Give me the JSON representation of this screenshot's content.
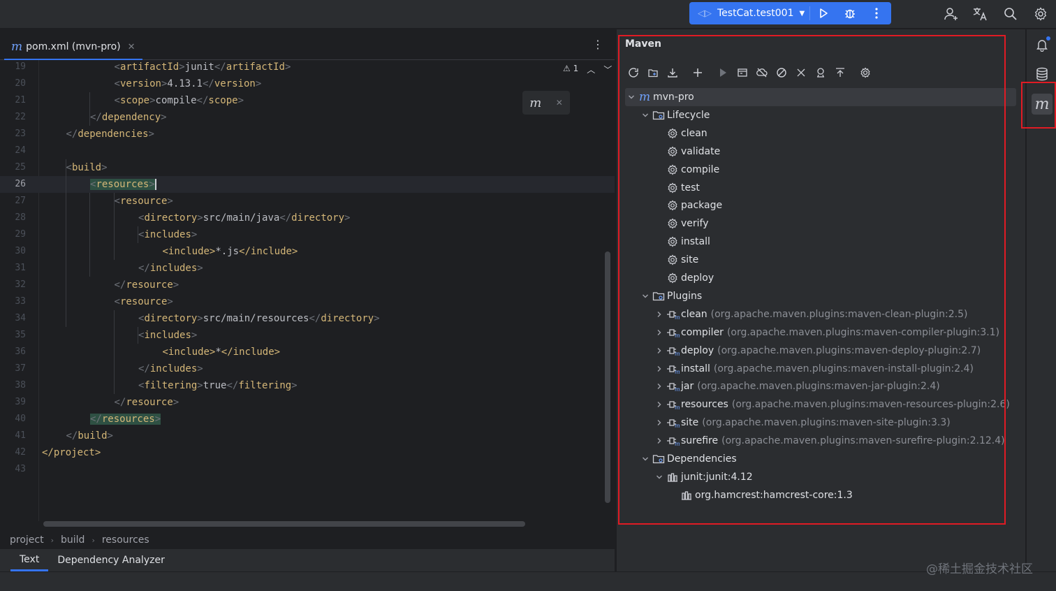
{
  "titlebar": {
    "run_config": "TestCat.test001",
    "icons": [
      "run-icon",
      "debug-icon",
      "more-vertical-icon",
      "add-user-icon",
      "translate-icon",
      "search-icon",
      "settings-icon"
    ]
  },
  "editor": {
    "tab": {
      "icon": "m",
      "label": "pom.xml (mvn-pro)"
    },
    "inspection": {
      "warnings": "1"
    },
    "popup_icon": "m",
    "lines": [
      {
        "n": "19",
        "i": 3,
        "seg": [
          [
            "br",
            "<"
          ],
          [
            "tg",
            "artifactId"
          ],
          [
            "br",
            ">"
          ],
          [
            "tx",
            "junit"
          ],
          [
            "br",
            "</"
          ],
          [
            "tg",
            "artifactId"
          ],
          [
            "br",
            ">"
          ]
        ]
      },
      {
        "n": "20",
        "i": 3,
        "seg": [
          [
            "br",
            "<"
          ],
          [
            "tg",
            "version"
          ],
          [
            "br",
            ">"
          ],
          [
            "tx",
            "4.13.1"
          ],
          [
            "br",
            "</"
          ],
          [
            "tg",
            "version"
          ],
          [
            "br",
            ">"
          ]
        ]
      },
      {
        "n": "21",
        "i": 3,
        "seg": [
          [
            "br",
            "<"
          ],
          [
            "tg",
            "scope"
          ],
          [
            "br",
            ">"
          ],
          [
            "tx",
            "compile"
          ],
          [
            "br",
            "</"
          ],
          [
            "tg",
            "scope"
          ],
          [
            "br",
            ">"
          ]
        ]
      },
      {
        "n": "22",
        "i": 2,
        "seg": [
          [
            "br",
            "</"
          ],
          [
            "tg",
            "dependency"
          ],
          [
            "br",
            ">"
          ]
        ]
      },
      {
        "n": "23",
        "i": 1,
        "seg": [
          [
            "br",
            "</"
          ],
          [
            "tg",
            "dependencies"
          ],
          [
            "br",
            ">"
          ]
        ]
      },
      {
        "n": "24",
        "i": 0,
        "seg": []
      },
      {
        "n": "25",
        "i": 1,
        "seg": [
          [
            "br",
            "<"
          ],
          [
            "tg",
            "build"
          ],
          [
            "br",
            ">"
          ]
        ]
      },
      {
        "n": "26",
        "i": 2,
        "current": true,
        "seg": [
          [
            "hlbr",
            "<"
          ],
          [
            "hl",
            "resources"
          ],
          [
            "hlbr",
            ">"
          ],
          [
            "cursor",
            ""
          ]
        ]
      },
      {
        "n": "27",
        "i": 3,
        "seg": [
          [
            "br",
            "<"
          ],
          [
            "tg",
            "resource"
          ],
          [
            "br",
            ">"
          ]
        ]
      },
      {
        "n": "28",
        "i": 4,
        "seg": [
          [
            "br",
            "<"
          ],
          [
            "tg",
            "directory"
          ],
          [
            "br",
            ">"
          ],
          [
            "tx",
            "src/main/java"
          ],
          [
            "br",
            "</"
          ],
          [
            "tg",
            "directory"
          ],
          [
            "br",
            ">"
          ]
        ]
      },
      {
        "n": "29",
        "i": 4,
        "seg": [
          [
            "br",
            "<"
          ],
          [
            "tg",
            "includes"
          ],
          [
            "br",
            ">"
          ]
        ]
      },
      {
        "n": "30",
        "i": 5,
        "seg": [
          [
            "tg",
            "<include>"
          ],
          [
            "tx",
            "*.js"
          ],
          [
            "tg",
            "</include>"
          ]
        ]
      },
      {
        "n": "31",
        "i": 4,
        "seg": [
          [
            "br",
            "</"
          ],
          [
            "tg",
            "includes"
          ],
          [
            "br",
            ">"
          ]
        ]
      },
      {
        "n": "32",
        "i": 3,
        "seg": [
          [
            "br",
            "</"
          ],
          [
            "tg",
            "resource"
          ],
          [
            "br",
            ">"
          ]
        ]
      },
      {
        "n": "33",
        "i": 3,
        "seg": [
          [
            "br",
            "<"
          ],
          [
            "tg",
            "resource"
          ],
          [
            "br",
            ">"
          ]
        ]
      },
      {
        "n": "34",
        "i": 4,
        "seg": [
          [
            "br",
            "<"
          ],
          [
            "tg",
            "directory"
          ],
          [
            "br",
            ">"
          ],
          [
            "tx",
            "src/main/resources"
          ],
          [
            "br",
            "</"
          ],
          [
            "tg",
            "directory"
          ],
          [
            "br",
            ">"
          ]
        ]
      },
      {
        "n": "35",
        "i": 4,
        "seg": [
          [
            "br",
            "<"
          ],
          [
            "tg",
            "includes"
          ],
          [
            "br",
            ">"
          ]
        ]
      },
      {
        "n": "36",
        "i": 5,
        "seg": [
          [
            "tg",
            "<include>"
          ],
          [
            "tx",
            "*"
          ],
          [
            "tg",
            "</include>"
          ]
        ]
      },
      {
        "n": "37",
        "i": 4,
        "seg": [
          [
            "br",
            "</"
          ],
          [
            "tg",
            "includes"
          ],
          [
            "br",
            ">"
          ]
        ]
      },
      {
        "n": "38",
        "i": 4,
        "seg": [
          [
            "br",
            "<"
          ],
          [
            "tg",
            "filtering"
          ],
          [
            "br",
            ">"
          ],
          [
            "tx",
            "true"
          ],
          [
            "br",
            "</"
          ],
          [
            "tg",
            "filtering"
          ],
          [
            "br",
            ">"
          ]
        ]
      },
      {
        "n": "39",
        "i": 3,
        "seg": [
          [
            "br",
            "</"
          ],
          [
            "tg",
            "resource"
          ],
          [
            "br",
            ">"
          ]
        ]
      },
      {
        "n": "40",
        "i": 2,
        "seg": [
          [
            "hlbr",
            "</"
          ],
          [
            "hl",
            "resources"
          ],
          [
            "hlbr",
            ">"
          ]
        ]
      },
      {
        "n": "41",
        "i": 1,
        "seg": [
          [
            "br",
            "</"
          ],
          [
            "tg",
            "build"
          ],
          [
            "br",
            ">"
          ]
        ]
      },
      {
        "n": "42",
        "i": 0,
        "seg": [
          [
            "tg",
            "</project>"
          ]
        ]
      },
      {
        "n": "43",
        "i": 0,
        "seg": []
      }
    ],
    "breadcrumb": [
      "project",
      "build",
      "resources"
    ],
    "bottom_tabs": [
      "Text",
      "Dependency Analyzer"
    ]
  },
  "maven": {
    "title": "Maven",
    "toolbar": [
      "reload-icon",
      "add-folder-icon",
      "download-icon",
      "add-icon",
      "run-icon",
      "run-config-icon",
      "offline-icon",
      "skip-tests-icon",
      "collapse-icon",
      "analyze-icon",
      "show-dependencies-icon",
      "settings-icon"
    ],
    "tree": [
      {
        "level": 0,
        "chev": "down",
        "icon": "m",
        "label": "mvn-pro",
        "selected": true
      },
      {
        "level": 1,
        "chev": "down",
        "icon": "folder",
        "label": "Lifecycle"
      },
      {
        "level": 2,
        "icon": "gear",
        "label": "clean"
      },
      {
        "level": 2,
        "icon": "gear",
        "label": "validate"
      },
      {
        "level": 2,
        "icon": "gear",
        "label": "compile"
      },
      {
        "level": 2,
        "icon": "gear",
        "label": "test"
      },
      {
        "level": 2,
        "icon": "gear",
        "label": "package"
      },
      {
        "level": 2,
        "icon": "gear",
        "label": "verify"
      },
      {
        "level": 2,
        "icon": "gear",
        "label": "install"
      },
      {
        "level": 2,
        "icon": "gear",
        "label": "site"
      },
      {
        "level": 2,
        "icon": "gear",
        "label": "deploy"
      },
      {
        "level": 1,
        "chev": "down",
        "icon": "folder",
        "label": "Plugins"
      },
      {
        "level": 2,
        "chev": "right",
        "icon": "plugin",
        "label": "clean",
        "coord": "(org.apache.maven.plugins:maven-clean-plugin:2.5)"
      },
      {
        "level": 2,
        "chev": "right",
        "icon": "plugin",
        "label": "compiler",
        "coord": "(org.apache.maven.plugins:maven-compiler-plugin:3.1)"
      },
      {
        "level": 2,
        "chev": "right",
        "icon": "plugin",
        "label": "deploy",
        "coord": "(org.apache.maven.plugins:maven-deploy-plugin:2.7)"
      },
      {
        "level": 2,
        "chev": "right",
        "icon": "plugin",
        "label": "install",
        "coord": "(org.apache.maven.plugins:maven-install-plugin:2.4)"
      },
      {
        "level": 2,
        "chev": "right",
        "icon": "plugin",
        "label": "jar",
        "coord": "(org.apache.maven.plugins:maven-jar-plugin:2.4)"
      },
      {
        "level": 2,
        "chev": "right",
        "icon": "plugin",
        "label": "resources",
        "coord": "(org.apache.maven.plugins:maven-resources-plugin:2.6)"
      },
      {
        "level": 2,
        "chev": "right",
        "icon": "plugin",
        "label": "site",
        "coord": "(org.apache.maven.plugins:maven-site-plugin:3.3)"
      },
      {
        "level": 2,
        "chev": "right",
        "icon": "plugin",
        "label": "surefire",
        "coord": "(org.apache.maven.plugins:maven-surefire-plugin:2.12.4)"
      },
      {
        "level": 1,
        "chev": "down",
        "icon": "folder",
        "label": "Dependencies"
      },
      {
        "level": 2,
        "chev": "down",
        "icon": "library",
        "label": "junit:junit:4.12"
      },
      {
        "level": 3,
        "icon": "library",
        "label": "org.hamcrest:hamcrest-core:1.3"
      }
    ]
  },
  "right_strip": [
    "notifications-icon",
    "database-icon",
    "maven-icon"
  ],
  "watermark": "@稀土掘金技术社区",
  "colors": {
    "accent": "#3574f0",
    "highlight_border": "#e01b24",
    "tag": "#d5b778",
    "text": "#bcbec4"
  }
}
